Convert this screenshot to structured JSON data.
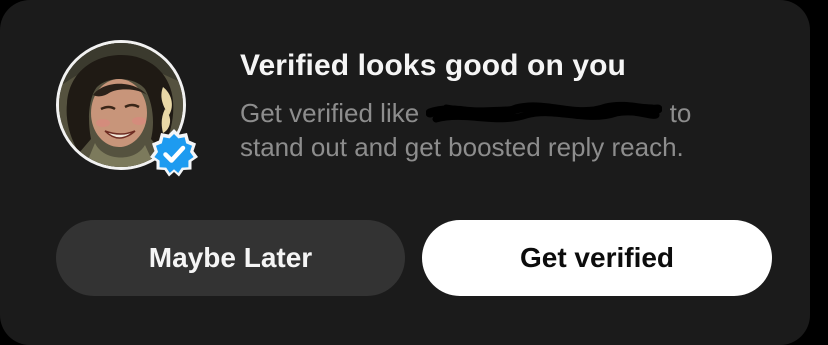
{
  "prompt": {
    "title": "Verified looks good on you",
    "description_before": "Get verified like",
    "description_after": "to stand out and get boosted reply reach.",
    "badge_icon": "verified-checkmark-icon",
    "badge_color": "#1d9bf0",
    "avatar_icon": "user-avatar"
  },
  "actions": {
    "maybe_later_label": "Maybe Later",
    "get_verified_label": "Get verified"
  }
}
